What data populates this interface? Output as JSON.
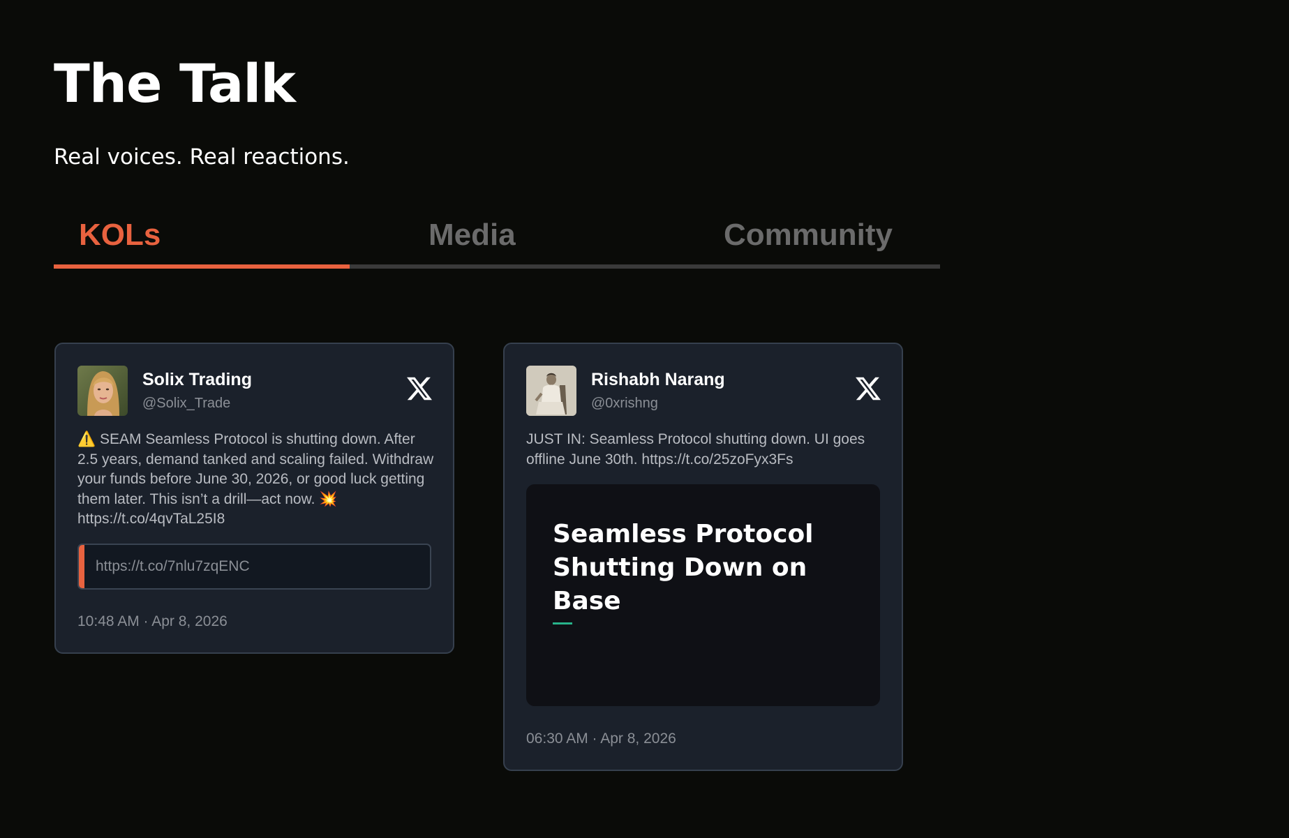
{
  "page": {
    "title": "The Talk",
    "subtitle": "Real voices. Real reactions."
  },
  "tabs": [
    {
      "label": "KOLs",
      "active": true
    },
    {
      "label": "Media",
      "active": false
    },
    {
      "label": "Community",
      "active": false
    }
  ],
  "colors": {
    "accent": "#e8623f",
    "background": "#0a0b08",
    "card": "#1b212b",
    "muted_text": "#8b8f96"
  },
  "posts": [
    {
      "author": "Solix Trading",
      "handle": "@Solix_Trade",
      "avatar_icon": "avatar-woman-portrait",
      "platform_icon": "x-logo-icon",
      "text": "⚠️ SEAM Seamless Protocol is shutting down. After 2.5 years, demand tanked and scaling failed. Withdraw your funds before June 30, 2026, or good luck getting them later. This isn’t a drill—act now. 💥 https://t.co/4qvTaL25I8",
      "link": "https://t.co/7nlu7zqENC",
      "timestamp": "10:48 AM · Apr 8, 2026"
    },
    {
      "author": "Rishabh Narang",
      "handle": "@0xrishng",
      "avatar_icon": "avatar-man-sepia-portrait",
      "platform_icon": "x-logo-icon",
      "text": "JUST IN: Seamless Protocol shutting down. UI goes offline June 30th. https://t.co/25zoFyx3Fs",
      "media_title": "Seamless Protocol Shutting Down on Base",
      "timestamp": "06:30 AM · Apr 8, 2026"
    }
  ]
}
